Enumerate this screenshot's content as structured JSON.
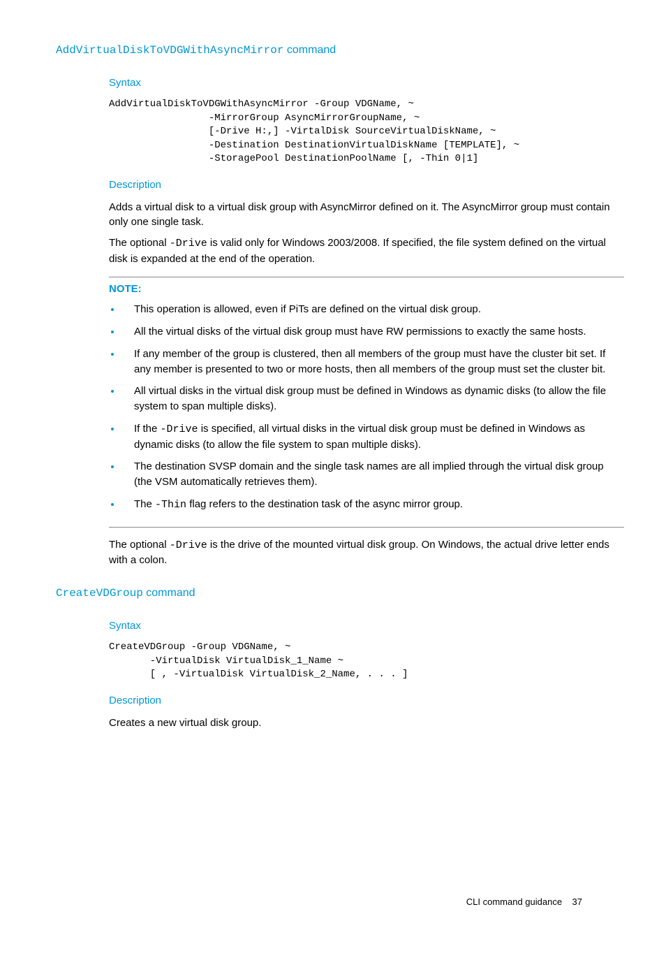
{
  "section1": {
    "title_code": "AddVirtualDiskToVDGWithAsyncMirror",
    "title_rest": " command",
    "syntax_label": "Syntax",
    "syntax_code": "AddVirtualDiskToVDGWithAsyncMirror -Group VDGName, ~\n                 -MirrorGroup AsyncMirrorGroupName, ~\n                 [-Drive H:,] -VirtalDisk SourceVirtualDiskName, ~\n                 -Destination DestinationVirtualDiskName [TEMPLATE], ~\n                 -StoragePool DestinationPoolName [, -Thin 0|1]",
    "description_label": "Description",
    "description_p1": "Adds a virtual disk to a virtual disk group with AsyncMirror defined on it. The AsyncMirror group must contain only one single task.",
    "desc_p2_a": "The optional ",
    "desc_p2_code": "-Drive",
    "desc_p2_b": " is valid only for Windows 2003/2008. If specified, the file system defined on the virtual disk is expanded at the end of the operation.",
    "note_label": "NOTE:",
    "bullets": {
      "b1": "This operation is allowed, even if PiTs are defined on the virtual disk group.",
      "b2": "All the virtual disks of the virtual disk group must have RW permissions to exactly the same hosts.",
      "b3": "If any member of the group is clustered, then all members of the group must have the cluster bit set. If any member is presented to two or more hosts, then all members of the group must set the cluster bit.",
      "b4": "All virtual disks in the virtual disk group must be defined in Windows as dynamic disks (to allow the file system to span multiple disks).",
      "b5a": "If the ",
      "b5code": "-Drive",
      "b5b": " is specified, all virtual disks in the virtual disk group must be defined in Windows as dynamic disks (to allow the file system to span multiple disks).",
      "b6": "The destination SVSP domain and the single task names are all implied through the virtual disk group (the VSM automatically retrieves them).",
      "b7a": "The ",
      "b7code": "-Thin",
      "b7b": " flag refers to the destination task of the async mirror group."
    },
    "after_p_a": "The optional ",
    "after_p_code": "-Drive",
    "after_p_b": " is the drive of the mounted virtual disk group. On Windows, the actual drive letter ends with a colon."
  },
  "section2": {
    "title_code": "CreateVDGroup",
    "title_rest": " command",
    "syntax_label": "Syntax",
    "syntax_code": "CreateVDGroup -Group VDGName, ~\n       -VirtualDisk VirtualDisk_1_Name ~\n       [ , -VirtualDisk VirtualDisk_2_Name, . . . ]",
    "description_label": "Description",
    "description_p1": "Creates a new virtual disk group."
  },
  "footer": {
    "text": "CLI command guidance",
    "page": "37"
  }
}
